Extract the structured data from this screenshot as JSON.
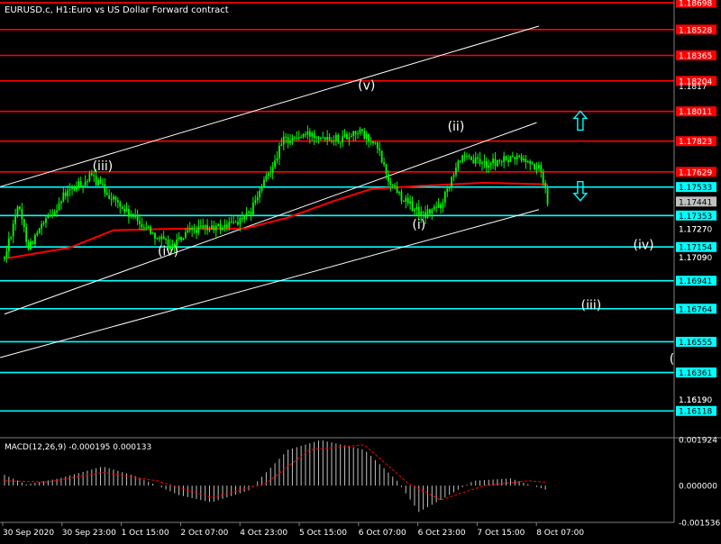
{
  "header": {
    "symbol": "EURUSD.c, H1:",
    "description": "Euro vs US Dollar Forward contract"
  },
  "colors": {
    "background": "#000000",
    "candle": "#00ff00",
    "ma": "#ff0000",
    "resistance": "#ff0000",
    "support": "#00ffff",
    "channel": "#ffffff",
    "axis_text": "#ffffff",
    "macd_hist": "#c0c0c0",
    "macd_signal": "#ff0000",
    "current_price_label": "#c0c0c0",
    "arrow": "#00ffff"
  },
  "chart_data": [
    {
      "type": "candlestick",
      "title": "",
      "xlabel": "",
      "ylabel": "",
      "ylim": [
        1.1596,
        1.18715
      ],
      "x_tick_labels": [
        "30 Sep 2020",
        "30 Sep 23:00",
        "1 Oct 15:00",
        "2 Oct 07:00",
        "4 Oct 23:00",
        "5 Oct 15:00",
        "6 Oct 07:00",
        "6 Oct 23:00",
        "7 Oct 15:00",
        "8 Oct 07:00"
      ],
      "y_tick_labels": [
        "1.18698",
        "1.18528",
        "1.18365",
        "1.18204",
        "1.18011",
        "1.17823",
        "1.17629",
        "1.17533",
        "1.17441",
        "1.17353",
        "1.17270",
        "1.17154",
        "1.17090",
        "1.16941",
        "1.16764",
        "1.16555",
        "1.16361",
        "1.16190",
        "1.16118"
      ],
      "plain_y_ticks": [
        1.1817,
        1.1727,
        1.1709,
        1.1619
      ],
      "resistance_levels": [
        1.18698,
        1.18528,
        1.18365,
        1.18204,
        1.18011,
        1.17823,
        1.17629
      ],
      "support_levels": [
        1.17533,
        1.17353,
        1.17154,
        1.16941,
        1.16764,
        1.16555,
        1.16361,
        1.16118
      ],
      "current_price": 1.17441,
      "price_path": [
        {
          "bar": 0,
          "price": 1.1708
        },
        {
          "bar": 6,
          "price": 1.1742
        },
        {
          "bar": 11,
          "price": 1.1716
        },
        {
          "bar": 28,
          "price": 1.1749
        },
        {
          "bar": 40,
          "price": 1.176
        },
        {
          "bar": 56,
          "price": 1.1737
        },
        {
          "bar": 66,
          "price": 1.1727
        },
        {
          "bar": 76,
          "price": 1.1715
        },
        {
          "bar": 86,
          "price": 1.1726
        },
        {
          "bar": 100,
          "price": 1.1728
        },
        {
          "bar": 112,
          "price": 1.1735
        },
        {
          "bar": 128,
          "price": 1.1783
        },
        {
          "bar": 142,
          "price": 1.1787
        },
        {
          "bar": 154,
          "price": 1.1784
        },
        {
          "bar": 162,
          "price": 1.1789
        },
        {
          "bar": 171,
          "price": 1.1778
        },
        {
          "bar": 176,
          "price": 1.1758
        },
        {
          "bar": 184,
          "price": 1.1744
        },
        {
          "bar": 192,
          "price": 1.1735
        },
        {
          "bar": 200,
          "price": 1.1742
        },
        {
          "bar": 208,
          "price": 1.1771
        },
        {
          "bar": 222,
          "price": 1.1768
        },
        {
          "bar": 236,
          "price": 1.1772
        },
        {
          "bar": 246,
          "price": 1.1764
        },
        {
          "bar": 249,
          "price": 1.1745
        }
      ],
      "moving_average": [
        {
          "bar": 0,
          "price": 1.1708
        },
        {
          "bar": 30,
          "price": 1.1715
        },
        {
          "bar": 50,
          "price": 1.1726
        },
        {
          "bar": 80,
          "price": 1.1727
        },
        {
          "bar": 110,
          "price": 1.1727
        },
        {
          "bar": 130,
          "price": 1.1734
        },
        {
          "bar": 150,
          "price": 1.1744
        },
        {
          "bar": 168,
          "price": 1.1752
        },
        {
          "bar": 190,
          "price": 1.1754
        },
        {
          "bar": 220,
          "price": 1.1756
        },
        {
          "bar": 249,
          "price": 1.1755
        }
      ],
      "channel_lines": [
        {
          "from_bar": -2,
          "from_price": 1.17535,
          "to_bar": 245,
          "to_price": 1.1855
        },
        {
          "from_bar": -2,
          "from_price": 1.16455,
          "to_bar": 245,
          "to_price": 1.1739
        },
        {
          "from_bar": 0,
          "from_price": 1.1673,
          "to_bar": 244,
          "to_price": 1.1794
        }
      ],
      "wave_labels": [
        {
          "text": "(iii)",
          "bar": 45,
          "price": 1.1764
        },
        {
          "text": "(iv)",
          "bar": 75,
          "price": 1.171
        },
        {
          "text": "(v)",
          "bar": 166,
          "price": 1.1815
        },
        {
          "text": "(i)",
          "bar": 190,
          "price": 1.1727
        },
        {
          "text": "(ii)",
          "bar": 207,
          "price": 1.1789
        },
        {
          "text": "(iv)",
          "bar": 293,
          "price": 1.1714
        },
        {
          "text": "(iii)",
          "bar": 269,
          "price": 1.1676
        },
        {
          "text": "(",
          "bar": 306,
          "price": 1.1642
        }
      ],
      "arrows": [
        {
          "direction": "up",
          "bar": 264,
          "price": 1.1795
        },
        {
          "direction": "down",
          "bar": 264,
          "price": 1.1751
        }
      ]
    },
    {
      "type": "histogram",
      "title": "MACD(12,26,9) -0.000195 0.000133",
      "ylim": [
        -0.001536,
        0.001924
      ],
      "y_tick_labels": [
        "0.001924",
        "0.000000",
        "-0.001536"
      ],
      "macd_path": [
        {
          "bar": 0,
          "value": 0.00045
        },
        {
          "bar": 10,
          "value": 5e-05
        },
        {
          "bar": 25,
          "value": 0.0003
        },
        {
          "bar": 45,
          "value": 0.0008
        },
        {
          "bar": 60,
          "value": 0.0004
        },
        {
          "bar": 80,
          "value": -0.0004
        },
        {
          "bar": 95,
          "value": -0.0007
        },
        {
          "bar": 112,
          "value": -0.0002
        },
        {
          "bar": 130,
          "value": 0.0015
        },
        {
          "bar": 145,
          "value": 0.0019
        },
        {
          "bar": 165,
          "value": 0.0015
        },
        {
          "bar": 180,
          "value": 0.0002
        },
        {
          "bar": 190,
          "value": -0.0011
        },
        {
          "bar": 200,
          "value": -0.0006
        },
        {
          "bar": 215,
          "value": 0.0002
        },
        {
          "bar": 232,
          "value": 0.0003
        },
        {
          "bar": 249,
          "value": -0.0002
        }
      ],
      "signal_path": [
        {
          "bar": 0,
          "value": 0.0002
        },
        {
          "bar": 20,
          "value": 0.00015
        },
        {
          "bar": 45,
          "value": 0.00055
        },
        {
          "bar": 70,
          "value": 0.0002
        },
        {
          "bar": 95,
          "value": -0.0005
        },
        {
          "bar": 120,
          "value": 0.0001
        },
        {
          "bar": 140,
          "value": 0.0015
        },
        {
          "bar": 165,
          "value": 0.0017
        },
        {
          "bar": 185,
          "value": 0.0001
        },
        {
          "bar": 200,
          "value": -0.0006
        },
        {
          "bar": 220,
          "value": 0.0
        },
        {
          "bar": 240,
          "value": 0.0002
        },
        {
          "bar": 249,
          "value": 0.000133
        }
      ]
    }
  ]
}
